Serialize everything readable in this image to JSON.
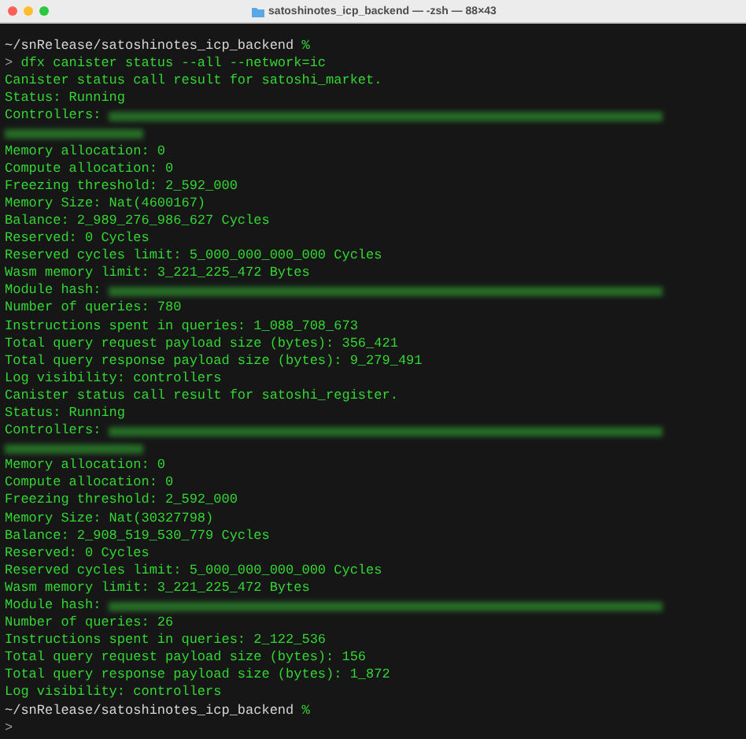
{
  "window": {
    "title": "satoshinotes_icp_backend — -zsh — 88×43"
  },
  "lines": [
    {
      "kind": "prompt",
      "path": "~/snRelease/satoshinotes_icp_backend",
      "symbol": "%"
    },
    {
      "kind": "command",
      "symbol": ">",
      "text": "dfx canister status --all --network=ic"
    },
    {
      "kind": "output",
      "text": "Canister status call result for satoshi_market."
    },
    {
      "kind": "output",
      "text": "Status: Running"
    },
    {
      "kind": "output",
      "text": "Controllers:",
      "redacted": true
    },
    {
      "kind": "redacted"
    },
    {
      "kind": "output",
      "text": "Memory allocation: 0"
    },
    {
      "kind": "output",
      "text": "Compute allocation: 0"
    },
    {
      "kind": "output",
      "text": "Freezing threshold: 2_592_000"
    },
    {
      "kind": "output",
      "text": "Memory Size: Nat(4600167)"
    },
    {
      "kind": "output",
      "text": "Balance: 2_989_276_986_627 Cycles"
    },
    {
      "kind": "output",
      "text": "Reserved: 0 Cycles"
    },
    {
      "kind": "output",
      "text": "Reserved cycles limit: 5_000_000_000_000 Cycles"
    },
    {
      "kind": "output",
      "text": "Wasm memory limit: 3_221_225_472 Bytes"
    },
    {
      "kind": "output",
      "text": "Module hash:",
      "redacted": true
    },
    {
      "kind": "output",
      "text": "Number of queries: 780"
    },
    {
      "kind": "output",
      "text": "Instructions spent in queries: 1_088_708_673"
    },
    {
      "kind": "output",
      "text": "Total query request payload size (bytes): 356_421"
    },
    {
      "kind": "output",
      "text": "Total query response payload size (bytes): 9_279_491"
    },
    {
      "kind": "output",
      "text": "Log visibility: controllers"
    },
    {
      "kind": "output",
      "text": "Canister status call result for satoshi_register."
    },
    {
      "kind": "output",
      "text": "Status: Running"
    },
    {
      "kind": "output",
      "text": "Controllers:",
      "redacted": true
    },
    {
      "kind": "redacted"
    },
    {
      "kind": "output",
      "text": "Memory allocation: 0"
    },
    {
      "kind": "output",
      "text": "Compute allocation: 0"
    },
    {
      "kind": "output",
      "text": "Freezing threshold: 2_592_000"
    },
    {
      "kind": "output",
      "text": "Memory Size: Nat(30327798)"
    },
    {
      "kind": "output",
      "text": "Balance: 2_908_519_530_779 Cycles"
    },
    {
      "kind": "output",
      "text": "Reserved: 0 Cycles"
    },
    {
      "kind": "output",
      "text": "Reserved cycles limit: 5_000_000_000_000 Cycles"
    },
    {
      "kind": "output",
      "text": "Wasm memory limit: 3_221_225_472 Bytes"
    },
    {
      "kind": "output",
      "text": "Module hash:",
      "redacted": true
    },
    {
      "kind": "output",
      "text": "Number of queries: 26"
    },
    {
      "kind": "output",
      "text": "Instructions spent in queries: 2_122_536"
    },
    {
      "kind": "output",
      "text": "Total query request payload size (bytes): 156"
    },
    {
      "kind": "output",
      "text": "Total query response payload size (bytes): 1_872"
    },
    {
      "kind": "output",
      "text": "Log visibility: controllers"
    },
    {
      "kind": "prompt",
      "path": "~/snRelease/satoshinotes_icp_backend",
      "symbol": "%"
    },
    {
      "kind": "command",
      "symbol": ">"
    }
  ]
}
